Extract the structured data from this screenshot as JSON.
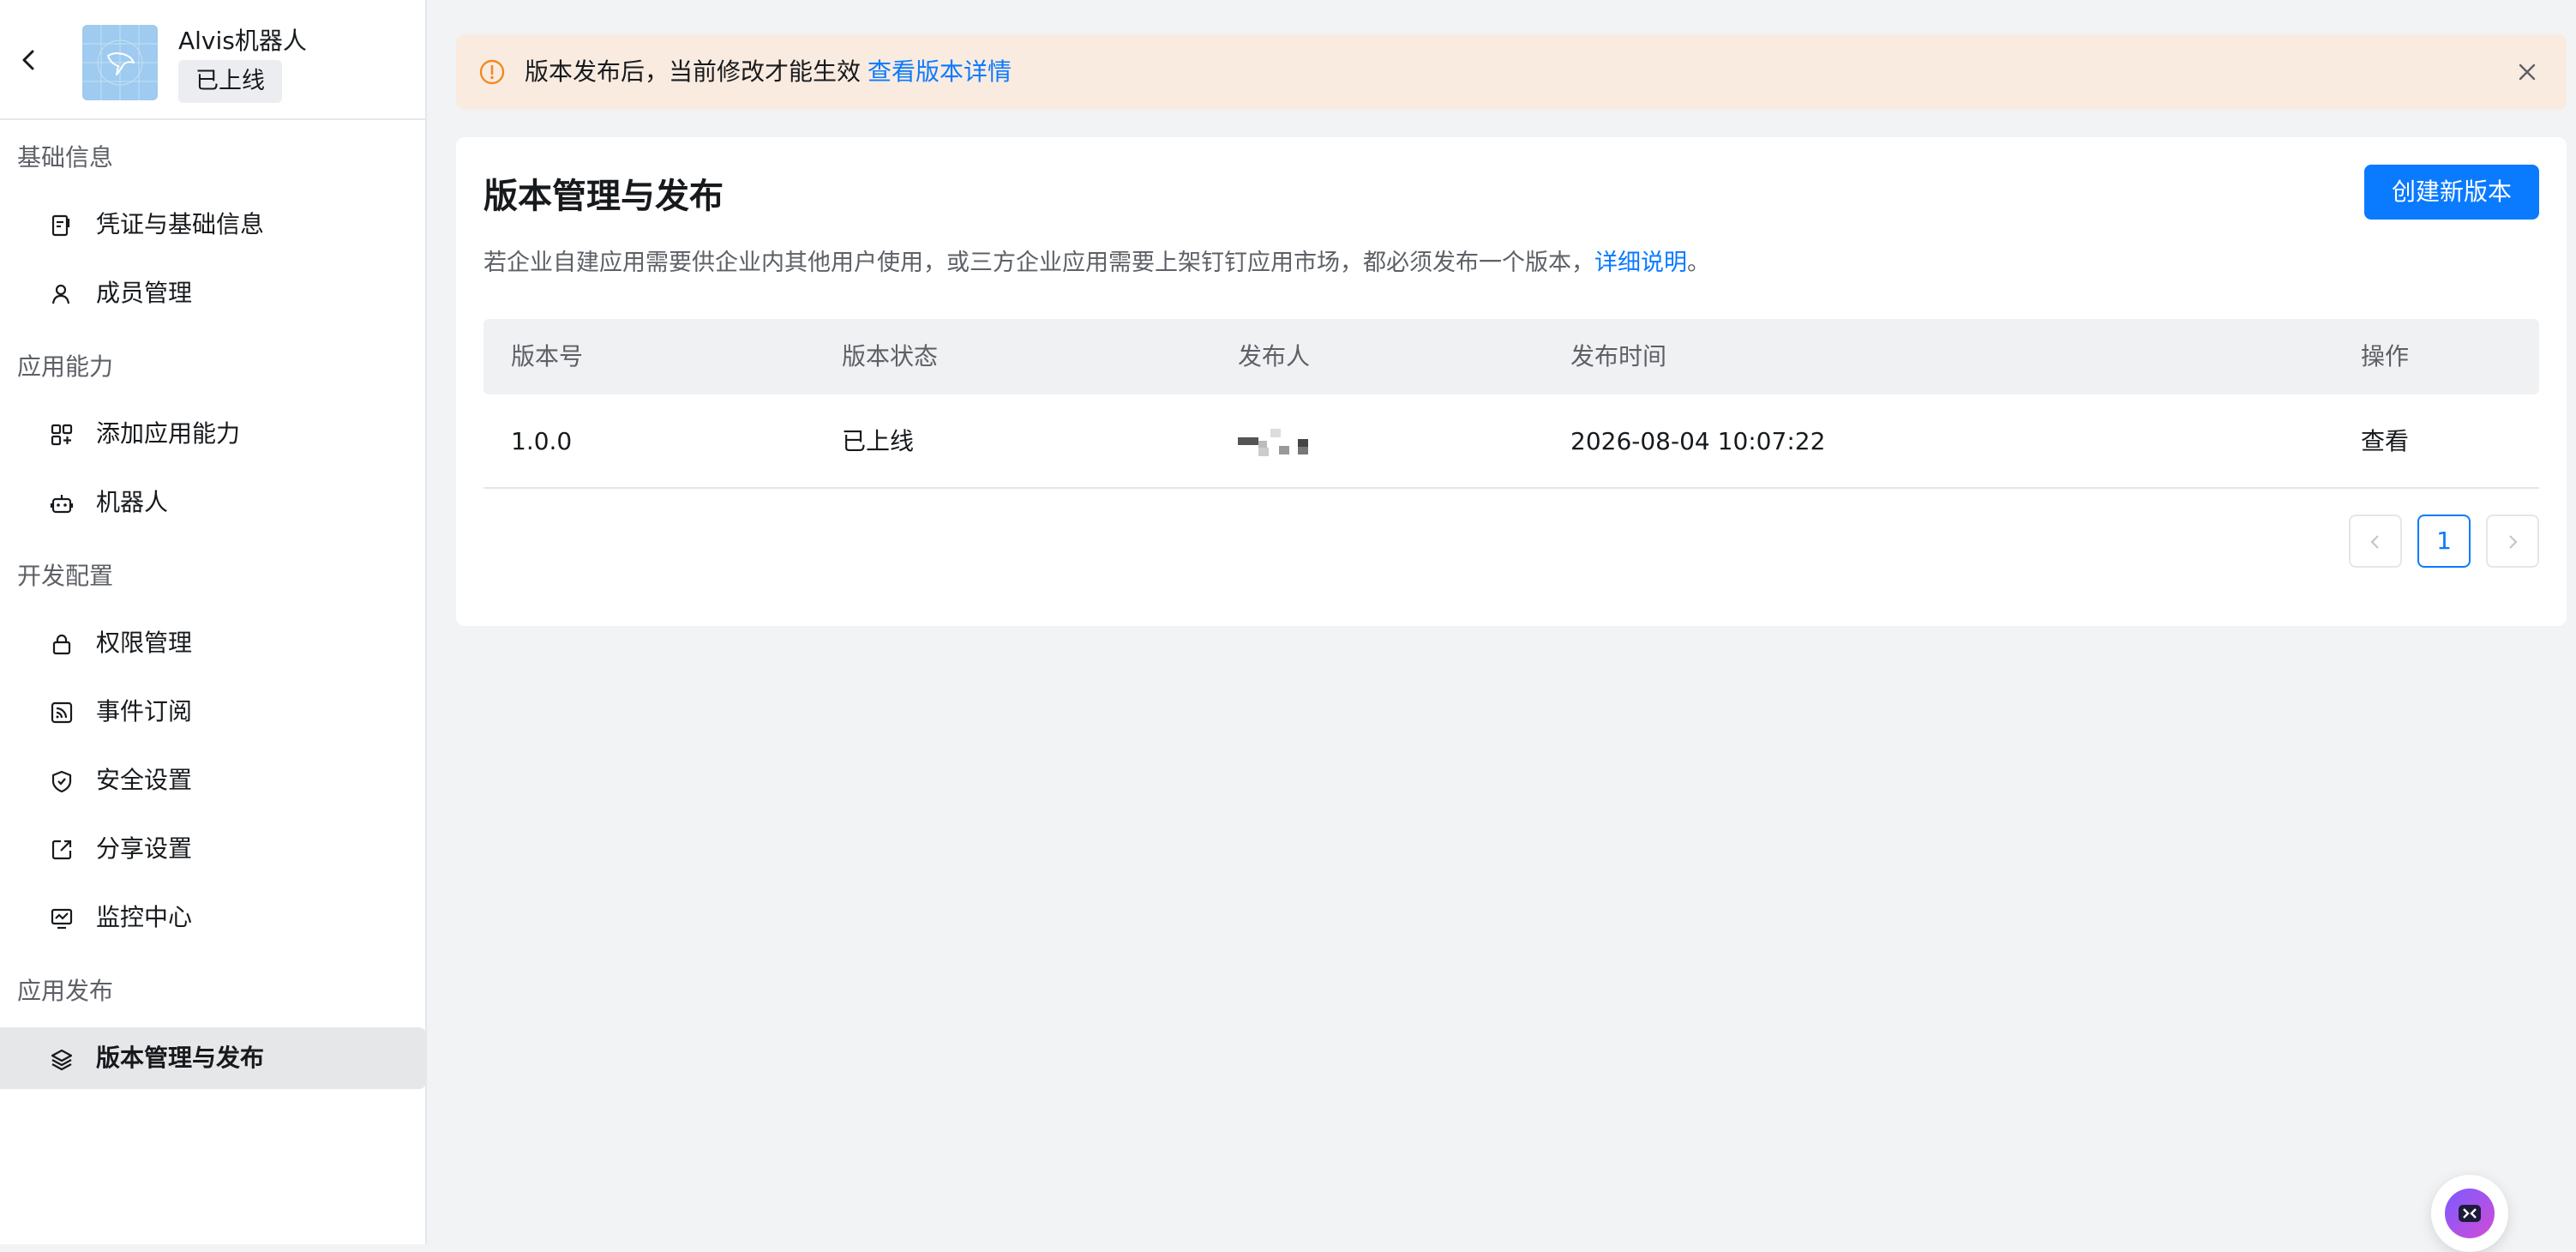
{
  "app": {
    "name": "Alvis机器人",
    "status_badge": "已上线"
  },
  "sidebar": {
    "groups": [
      {
        "title": "基础信息",
        "items": [
          {
            "label": "凭证与基础信息",
            "icon": "credential-icon"
          },
          {
            "label": "成员管理",
            "icon": "user-icon"
          }
        ]
      },
      {
        "title": "应用能力",
        "items": [
          {
            "label": "添加应用能力",
            "icon": "apps-add-icon"
          },
          {
            "label": "机器人",
            "icon": "robot-icon"
          }
        ]
      },
      {
        "title": "开发配置",
        "items": [
          {
            "label": "权限管理",
            "icon": "lock-icon"
          },
          {
            "label": "事件订阅",
            "icon": "rss-icon"
          },
          {
            "label": "安全设置",
            "icon": "shield-icon"
          },
          {
            "label": "分享设置",
            "icon": "share-icon"
          },
          {
            "label": "监控中心",
            "icon": "monitor-icon"
          }
        ]
      },
      {
        "title": "应用发布",
        "items": [
          {
            "label": "版本管理与发布",
            "icon": "layers-icon",
            "active": true
          }
        ]
      }
    ]
  },
  "alert": {
    "message": "版本发布后，当前修改才能生效",
    "link": "查看版本详情",
    "color": "#f9ebe0"
  },
  "main": {
    "title": "版本管理与发布",
    "create_button": "创建新版本",
    "description": "若企业自建应用需要供企业内其他用户使用，或三方企业应用需要上架钉钉应用市场，都必须发布一个版本，",
    "description_link": "详细说明",
    "description_end": "。",
    "table": {
      "headers": [
        "版本号",
        "版本状态",
        "发布人",
        "发布时间",
        "操作"
      ],
      "rows": [
        {
          "version": "1.0.0",
          "status": "已上线",
          "publisher": "",
          "time": "2026-08-04 10:07:22",
          "action": "查看"
        }
      ]
    },
    "pagination": {
      "current": "1"
    }
  },
  "colors": {
    "accent": "#0a7aff",
    "warning": "#f08a24"
  }
}
